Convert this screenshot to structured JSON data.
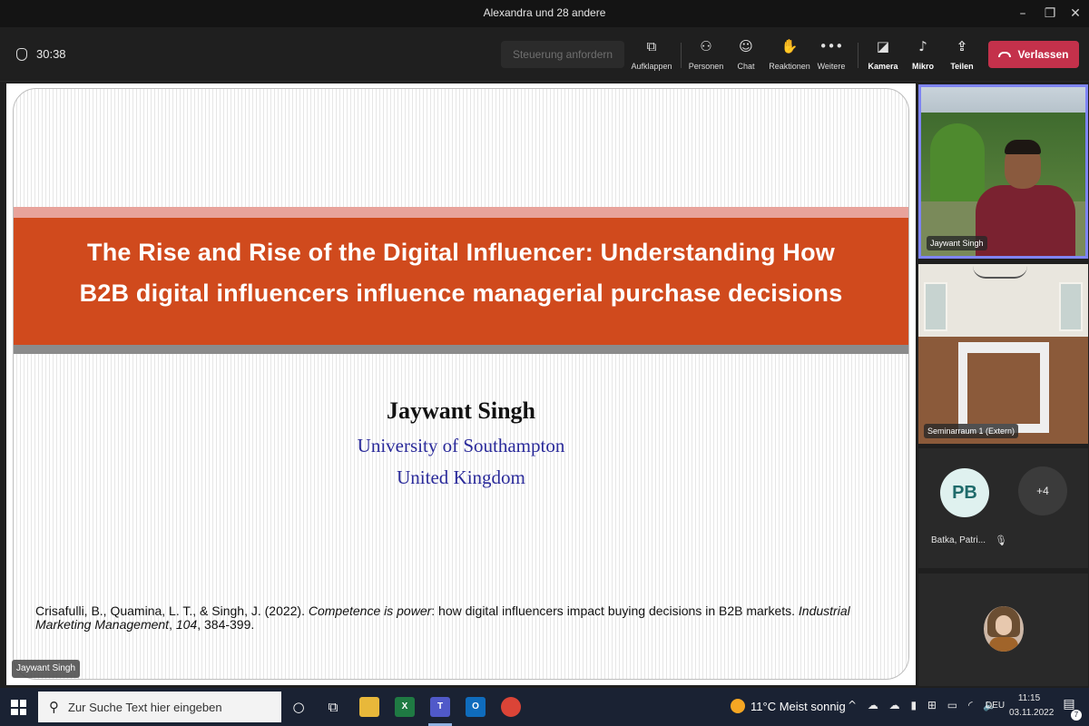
{
  "window": {
    "title": "Alexandra und 28 andere",
    "minimize_icon": "–",
    "maximize_icon": "❐",
    "close_icon": "✕"
  },
  "toolbar": {
    "timer": "30:38",
    "request_control": "Steuerung anfordern",
    "tools": [
      {
        "label": "Aufklappen",
        "icon": "⧉",
        "icon_name": "popout-icon"
      },
      {
        "label": "Personen",
        "icon": "⚇",
        "icon_name": "people-icon"
      },
      {
        "label": "Chat",
        "icon": "☺",
        "icon_name": "chat-icon"
      },
      {
        "label": "Reaktionen",
        "icon": "✋",
        "icon_name": "reactions-icon"
      },
      {
        "label": "Weitere",
        "icon": "•••",
        "icon_name": "more-icon"
      },
      {
        "label": "Kamera",
        "icon": "◪",
        "icon_name": "camera-off-icon"
      },
      {
        "label": "Mikro",
        "icon": "♪",
        "icon_name": "mic-off-icon"
      },
      {
        "label": "Teilen",
        "icon": "⇪",
        "icon_name": "share-icon"
      }
    ],
    "leave": "Verlassen",
    "leave_color": "#c4314b"
  },
  "slide": {
    "title_line1": "The Rise and Rise of the Digital Influencer: Understanding How",
    "title_line2": "B2B digital influencers influence managerial purchase decisions",
    "author": "Jaywant Singh",
    "affiliation": "University of Southampton",
    "country": "United Kingdom",
    "citation_authors": "Crisafulli, B., Quamina, L. T., & Singh, J. (2022). ",
    "citation_title": "Competence is power",
    "citation_rest": ": how digital influencers impact buying decisions in B2B markets. ",
    "citation_journal": "Industrial Marketing Management",
    "citation_sep": ", ",
    "citation_volume": "104",
    "citation_pages": ", 384-399.",
    "band_color": "#d04a1d",
    "presenter_tag": "Jaywant Singh"
  },
  "participants": {
    "speaker_name": "Jaywant Singh",
    "room_name": "Seminarraum 1 (Extern)",
    "pb_initials": "PB",
    "more_count": "+4",
    "pb_name": "Batka, Patri...",
    "mute_icon": "🎙"
  },
  "taskbar": {
    "search_placeholder": "Zur Suche Text hier eingeben",
    "weather": "11°C  Meist sonnig",
    "tray_icons": "^ ☁ ☁ ▮ ⊞ ▭ ◜ 🔈",
    "language": "DEU",
    "time": "11:15",
    "date": "03.11.2022",
    "notifications": "7"
  }
}
